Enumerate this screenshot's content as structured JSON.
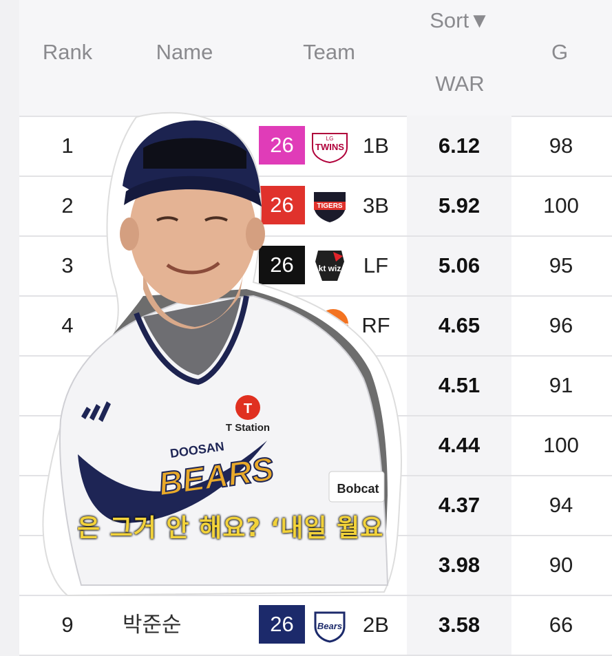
{
  "header": {
    "rank": "Rank",
    "name": "Name",
    "team": "Team",
    "sort": "Sort▼",
    "war": "WAR",
    "g": "G"
  },
  "rows": [
    {
      "rank": "1",
      "name": "",
      "num": "26",
      "num_color": "#e03cb8",
      "team_logo": "twins-logo",
      "pos": "1B",
      "war": "6.12",
      "g": "98"
    },
    {
      "rank": "2",
      "name": "",
      "num": "26",
      "num_color": "#e0322c",
      "team_logo": "tigers-logo",
      "pos": "3B",
      "war": "5.92",
      "g": "100"
    },
    {
      "rank": "3",
      "name": "",
      "num": "26",
      "num_color": "#111111",
      "team_logo": "ktwiz-logo",
      "pos": "LF",
      "war": "5.06",
      "g": "95"
    },
    {
      "rank": "4",
      "name": "",
      "num": "",
      "num_color": "",
      "team_logo": "eagles-logo",
      "pos": "RF",
      "war": "4.65",
      "g": "96"
    },
    {
      "rank": "",
      "name": "",
      "num": "",
      "num_color": "",
      "team_logo": "",
      "pos": "",
      "war": "4.51",
      "g": "91"
    },
    {
      "rank": "",
      "name": "",
      "num": "",
      "num_color": "",
      "team_logo": "",
      "pos": "",
      "war": "4.44",
      "g": "100"
    },
    {
      "rank": "",
      "name": "",
      "num": "",
      "num_color": "",
      "team_logo": "",
      "pos": "",
      "war": "4.37",
      "g": "94"
    },
    {
      "rank": "",
      "name": "",
      "num": "",
      "num_color": "",
      "team_logo": "",
      "pos": "",
      "war": "3.98",
      "g": "90"
    },
    {
      "rank": "9",
      "name": "박준순",
      "num": "26",
      "num_color": "#1c2a6b",
      "team_logo": "bears-logo",
      "pos": "2B",
      "war": "3.58",
      "g": "66"
    }
  ],
  "sticker": {
    "subtitle": "은 그거 안 해요? ‘내일 월요",
    "jersey_brand": "DOOSAN",
    "jersey_team": "BEARS",
    "sponsor": "T Station",
    "sleeve": "Bobcat"
  },
  "logos": {
    "twins": "TWINS",
    "twins_small": "LG",
    "tigers": "TIGERS",
    "ktwiz": "kt wiz",
    "eagles": "Eagles",
    "bears": "Bears"
  }
}
